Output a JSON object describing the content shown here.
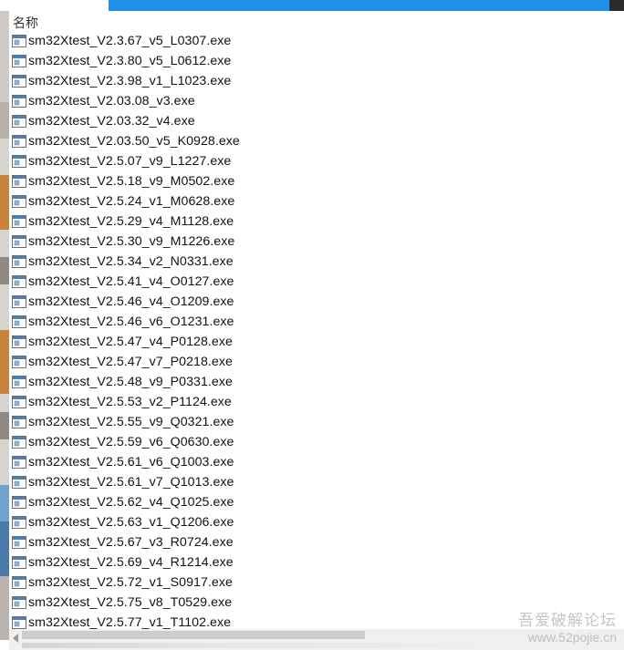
{
  "list": {
    "column_header": "名称",
    "file_icon": "executable-file-icon",
    "files": [
      "sm32Xtest_V2.3.67_v5_L0307.exe",
      "sm32Xtest_V2.3.80_v5_L0612.exe",
      "sm32Xtest_V2.3.98_v1_L1023.exe",
      "sm32Xtest_V2.03.08_v3.exe",
      "sm32Xtest_V2.03.32_v4.exe",
      "sm32Xtest_V2.03.50_v5_K0928.exe",
      "sm32Xtest_V2.5.07_v9_L1227.exe",
      "sm32Xtest_V2.5.18_v9_M0502.exe",
      "sm32Xtest_V2.5.24_v1_M0628.exe",
      "sm32Xtest_V2.5.29_v4_M1128.exe",
      "sm32Xtest_V2.5.30_v9_M1226.exe",
      "sm32Xtest_V2.5.34_v2_N0331.exe",
      "sm32Xtest_V2.5.41_v4_O0127.exe",
      "sm32Xtest_V2.5.46_v4_O1209.exe",
      "sm32Xtest_V2.5.46_v6_O1231.exe",
      "sm32Xtest_V2.5.47_v4_P0128.exe",
      "sm32Xtest_V2.5.47_v7_P0218.exe",
      "sm32Xtest_V2.5.48_v9_P0331.exe",
      "sm32Xtest_V2.5.53_v2_P1124.exe",
      "sm32Xtest_V2.5.55_v9_Q0321.exe",
      "sm32Xtest_V2.5.59_v6_Q0630.exe",
      "sm32Xtest_V2.5.61_v6_Q1003.exe",
      "sm32Xtest_V2.5.61_v7_Q1013.exe",
      "sm32Xtest_V2.5.62_v4_Q1025.exe",
      "sm32Xtest_V2.5.63_v1_Q1206.exe",
      "sm32Xtest_V2.5.67_v3_R0724.exe",
      "sm32Xtest_V2.5.69_v4_R1214.exe",
      "sm32Xtest_V2.5.72_v1_S0917.exe",
      "sm32Xtest_V2.5.75_v8_T0529.exe",
      "sm32Xtest_V2.5.77_v1_T1102.exe"
    ]
  },
  "watermark": {
    "line1": "吾爱破解论坛",
    "line2": "www.52pojie.cn"
  },
  "colors": {
    "title_bar_accent": "#1e90e8",
    "text": "#111111"
  }
}
